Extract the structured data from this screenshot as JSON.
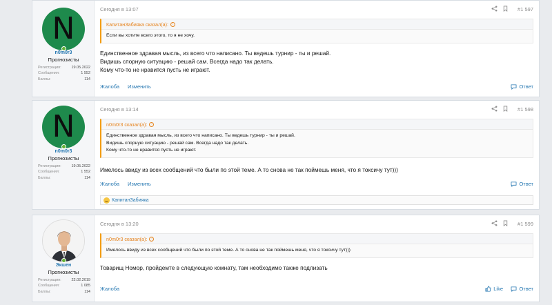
{
  "posts": [
    {
      "author": {
        "initial": "N",
        "name": "n0m0r3",
        "title": "Прогнозисты",
        "stats": [
          {
            "label": "Регистрация:",
            "value": "19.05.2022"
          },
          {
            "label": "Сообщения:",
            "value": "1 552"
          },
          {
            "label": "Баллы:",
            "value": "114"
          }
        ]
      },
      "date": "Сегодня в 13:07",
      "number": "#1 597",
      "quote": {
        "title": "КапитанЗабияка сказал(а):",
        "lines": [
          "Если вы хотите всего этого, то я не хочу."
        ]
      },
      "body": [
        "Единственное здравая мысль, из всего что написано. Ты ведешь турнир - ты и решай.",
        "Видишь спорную ситуацию - решай сам. Всегда надо так делать.",
        "Кому что-то не нравится пусть не играют."
      ],
      "actions": {
        "report": "Жалоба",
        "edit": "Изменить",
        "reply": "Ответ"
      }
    },
    {
      "author": {
        "initial": "N",
        "name": "n0m0r3",
        "title": "Прогнозисты",
        "stats": [
          {
            "label": "Регистрация:",
            "value": "19.05.2022"
          },
          {
            "label": "Сообщения:",
            "value": "1 552"
          },
          {
            "label": "Баллы:",
            "value": "114"
          }
        ]
      },
      "date": "Сегодня в 13:14",
      "number": "#1 598",
      "quote": {
        "title": "n0m0r3 сказал(а):",
        "lines": [
          "Единственное здравая мысль, из всего что написано. Ты ведешь турнир - ты и решай.",
          "Видишь спорную ситуацию - решай сам. Всегда надо так делать.",
          "Кому что-то не нравится пусть не играют."
        ]
      },
      "body": [
        "Имелось ввиду из всех сообщений что были по этой теме. А то снова не так поймешь меня, что я токсичу тут)))"
      ],
      "actions": {
        "report": "Жалоба",
        "edit": "Изменить",
        "reply": "Ответ"
      },
      "reaction_user": "КапитанЗабияка"
    },
    {
      "author": {
        "name": "Экшен",
        "title": "Прогнозисты",
        "stats": [
          {
            "label": "Регистрация:",
            "value": "22.02.2019"
          },
          {
            "label": "Сообщения:",
            "value": "1 085"
          },
          {
            "label": "Баллы:",
            "value": "114"
          }
        ]
      },
      "date": "Сегодня в 13:20",
      "number": "#1 599",
      "quote": {
        "title": "n0m0r3 сказал(а):",
        "lines": [
          "Имелось ввиду из всех сообщений что были по этой теме. А то снова не так поймешь меня, что я токсичу тут)))"
        ]
      },
      "body": [
        "Товарищ Номор, пройдемте в следующую комнату, там необходимо также подлизать"
      ],
      "actions": {
        "report": "Жалоба",
        "like": "Like",
        "reply": "Ответ"
      }
    }
  ]
}
